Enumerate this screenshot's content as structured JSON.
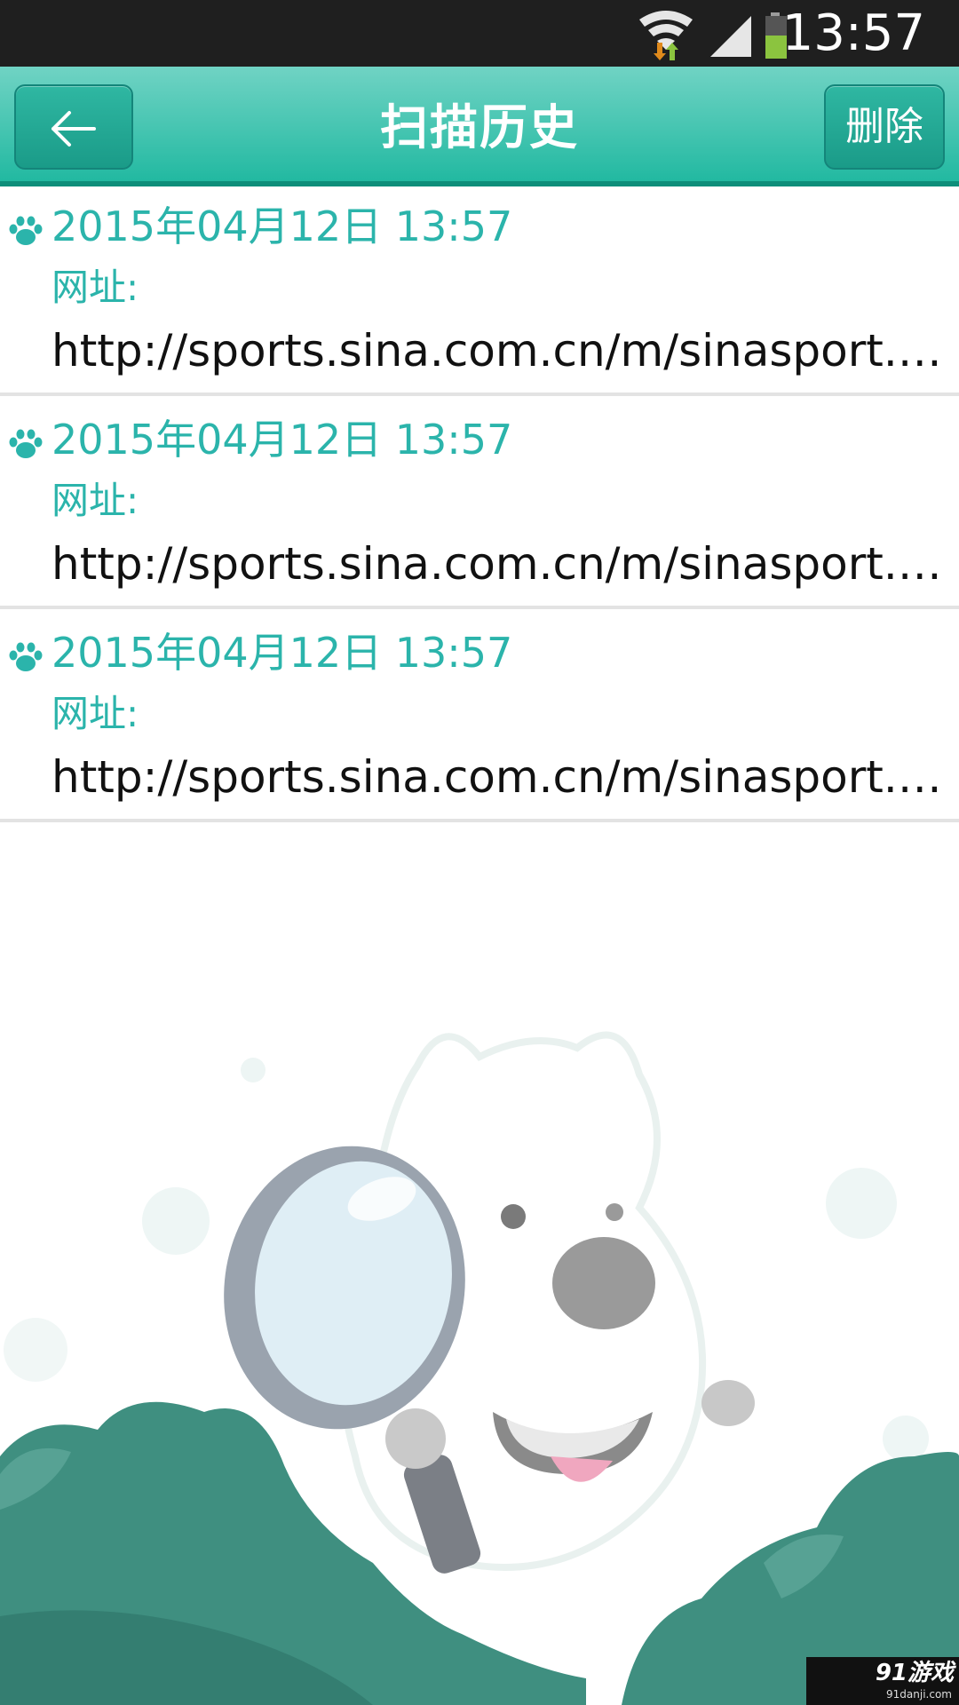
{
  "status_bar": {
    "time": "13:57",
    "wifi_icon": "wifi-icon",
    "signal_icon": "signal-icon",
    "battery_icon": "battery-icon"
  },
  "header": {
    "title": "扫描历史",
    "back_icon": "arrow-left-icon",
    "delete_label": "删除"
  },
  "history": [
    {
      "date": "2015年04月12日 13:57",
      "url_label": "网址:",
      "url": "http://sports.sina.com.cn/m/sinasport.h..."
    },
    {
      "date": "2015年04月12日 13:57",
      "url_label": "网址:",
      "url": "http://sports.sina.com.cn/m/sinasport.h..."
    },
    {
      "date": "2015年04月12日 13:57",
      "url_label": "网址:",
      "url": "http://sports.sina.com.cn/m/sinasport.h..."
    }
  ],
  "watermark": {
    "logo": "91游戏",
    "site": "91danji.com"
  },
  "colors": {
    "accent": "#2bb4ab",
    "header_top": "#70d3c4",
    "header_bottom": "#22b9a1",
    "bush": "#3f8f80"
  }
}
